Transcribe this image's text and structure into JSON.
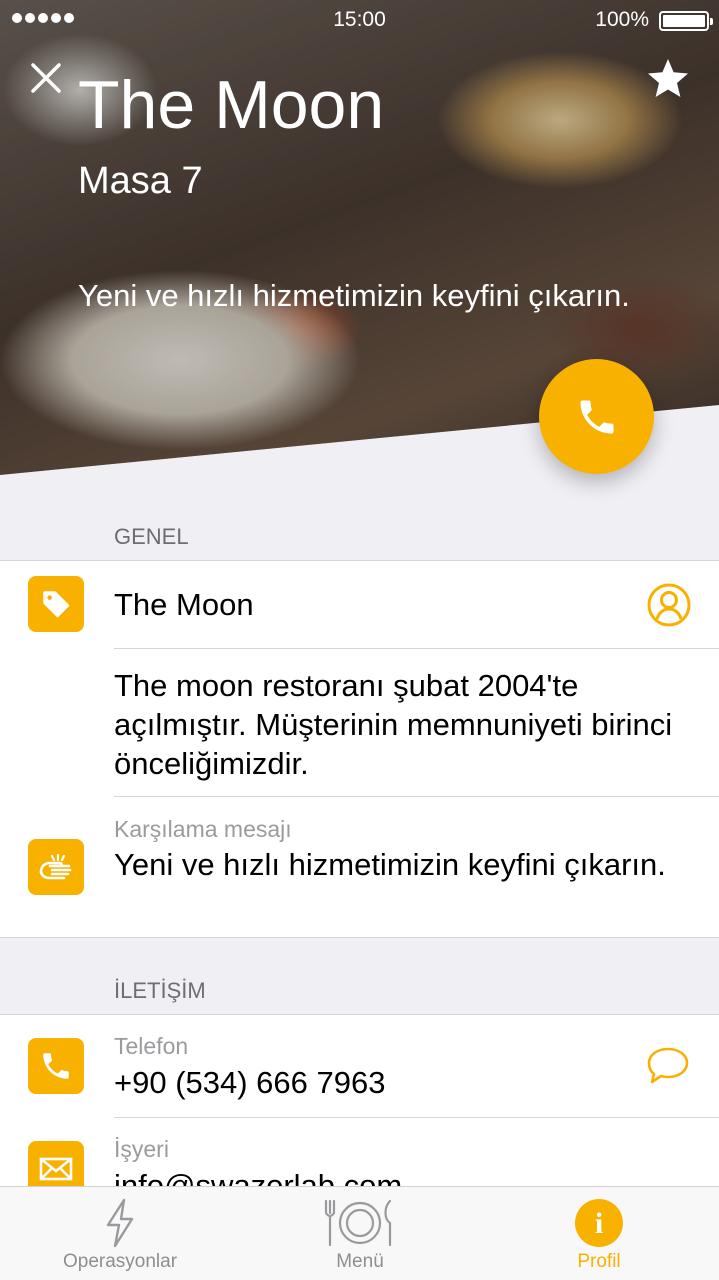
{
  "status_bar": {
    "time": "15:00",
    "battery": "100%"
  },
  "hero": {
    "title": "The Moon",
    "table": "Masa 7",
    "welcome": "Yeni ve hızlı hizmetimizin keyfini çıkarın."
  },
  "icons": {
    "close": "close-icon",
    "favorite": "star-icon",
    "call": "phone-icon",
    "name": "tag-icon",
    "welcome": "hand-icon",
    "phone": "phone-icon",
    "email": "mail-icon",
    "profile": "person-icon",
    "message": "chat-bubble-icon"
  },
  "colors": {
    "accent": "#f9b100",
    "background": "#efeff4",
    "muted": "#9b9b9f"
  },
  "general": {
    "header": "GENEL",
    "name": "The Moon",
    "description": "The moon restoranı şubat 2004'te açılmıştır. Müşterinin memnuniyeti birinci önceliğimizdir.",
    "welcome_label": "Karşılama mesajı",
    "welcome_text": "Yeni ve hızlı hizmetimizin keyfini çıkarın."
  },
  "contact": {
    "header": "İLETİŞİM",
    "phone_label": "Telefon",
    "phone": "+90 (534) 666 7963",
    "email_label": "İşyeri",
    "email": "info@swazerlab.com"
  },
  "tabs": [
    {
      "label": "Operasyonlar",
      "icon": "bolt-icon",
      "active": false
    },
    {
      "label": "Menü",
      "icon": "plate-icon",
      "active": false
    },
    {
      "label": "Profil",
      "icon": "info-icon",
      "active": true
    }
  ]
}
